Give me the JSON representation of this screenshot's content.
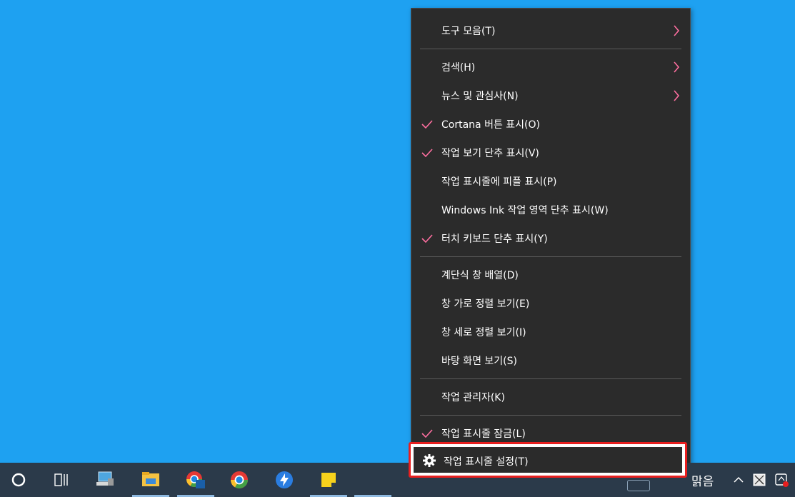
{
  "menu": {
    "items": [
      {
        "label": "도구 모음(T)",
        "checked": false,
        "submenu": true
      },
      {
        "label": "검색(H)",
        "checked": false,
        "submenu": true
      },
      {
        "label": "뉴스 및 관심사(N)",
        "checked": false,
        "submenu": true
      },
      {
        "label": "Cortana 버튼 표시(O)",
        "checked": true,
        "submenu": false
      },
      {
        "label": "작업 보기 단추 표시(V)",
        "checked": true,
        "submenu": false
      },
      {
        "label": "작업 표시줄에 피플 표시(P)",
        "checked": false,
        "submenu": false
      },
      {
        "label": "Windows Ink 작업 영역 단추 표시(W)",
        "checked": false,
        "submenu": false
      },
      {
        "label": "터치 키보드 단추 표시(Y)",
        "checked": true,
        "submenu": false
      },
      {
        "label": "계단식 창 배열(D)",
        "checked": false,
        "submenu": false
      },
      {
        "label": "창 가로 정렬 보기(E)",
        "checked": false,
        "submenu": false
      },
      {
        "label": "창 세로 정렬 보기(I)",
        "checked": false,
        "submenu": false
      },
      {
        "label": "바탕 화면 보기(S)",
        "checked": false,
        "submenu": false
      },
      {
        "label": "작업 관리자(K)",
        "checked": false,
        "submenu": false
      },
      {
        "label": "작업 표시줄 잠금(L)",
        "checked": true,
        "submenu": false
      },
      {
        "label": "작업 표시줄 설정(T)",
        "checked": false,
        "submenu": false,
        "icon": "gear-icon"
      }
    ]
  },
  "taskbar": {
    "weather_text": "맑음",
    "apps": [
      "cortana-circle-icon",
      "task-view-icon",
      "network-pc-icon",
      "file-explorer-icon",
      "chrome-beta-icon",
      "chrome-icon",
      "messenger-icon",
      "sticky-notes-icon",
      "blank-app"
    ]
  },
  "colors": {
    "desktop": "#1ea1f1",
    "menu_bg": "#2b2b2b",
    "check": "#ff6fa0",
    "highlight": "#e81f1f",
    "taskbar": "#2b3a4a"
  }
}
